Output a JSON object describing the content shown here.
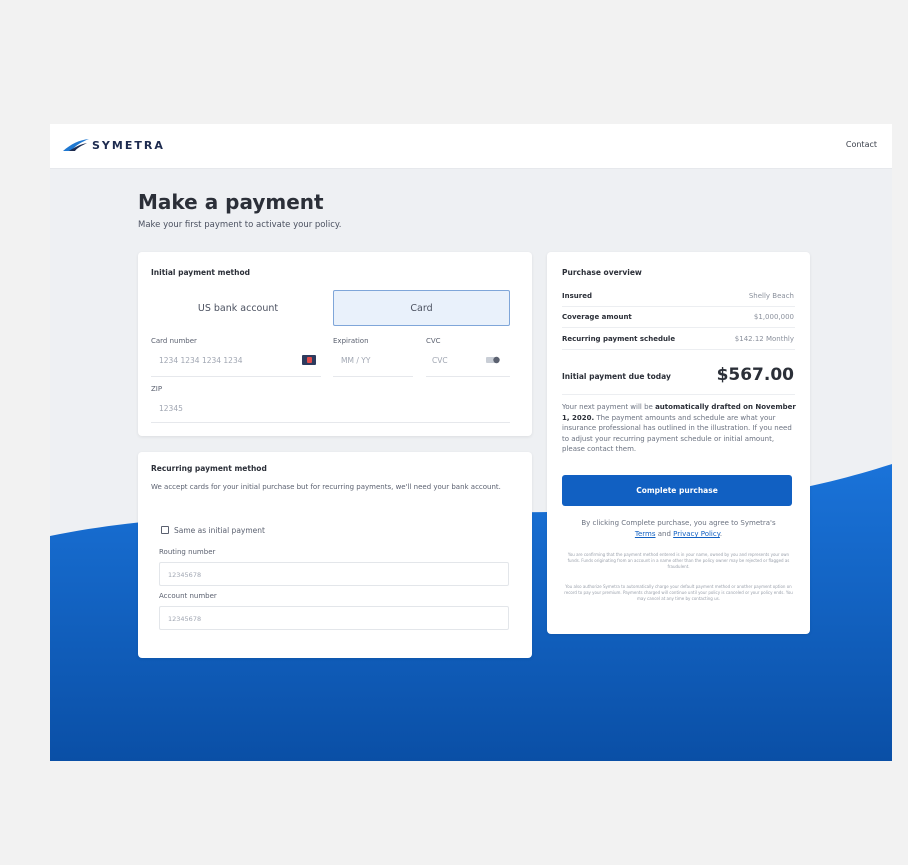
{
  "header": {
    "brand": "SYMETRA",
    "contact_label": "Contact",
    "brand_color": "#1d2b4f",
    "accent_color": "#1160c2"
  },
  "page": {
    "title": "Make a payment",
    "subtitle": "Make your first payment to activate your policy."
  },
  "initial_payment": {
    "section_title": "Initial payment method",
    "tabs": [
      {
        "label": "US bank account",
        "selected": false
      },
      {
        "label": "Card",
        "selected": true
      }
    ],
    "card_number_label": "Card number",
    "card_number_placeholder": "1234 1234 1234 1234",
    "expiration_label": "Expiration",
    "expiration_placeholder": "MM / YY",
    "cvc_label": "CVC",
    "cvc_placeholder": "CVC",
    "zip_label": "ZIP",
    "zip_placeholder": "12345"
  },
  "recurring_payment": {
    "section_title": "Recurring payment method",
    "description": "We accept cards for your initial purchase but for recurring payments, we'll need your bank account.",
    "same_as_initial_label": "Same as initial payment",
    "same_as_initial_checked": false,
    "routing_label": "Routing number",
    "routing_placeholder": "12345678",
    "account_label": "Account number",
    "account_placeholder": "12345678"
  },
  "overview": {
    "section_title": "Purchase overview",
    "rows": [
      {
        "label": "Insured",
        "value": "Shelly Beach"
      },
      {
        "label": "Coverage amount",
        "value": "$1,000,000"
      },
      {
        "label": "Recurring payment schedule",
        "value": "$142.12 Monthly"
      }
    ],
    "due_label": "Initial payment due today",
    "due_value": "$567.00",
    "note_prefix": "Your next payment will be ",
    "note_bold": "automatically drafted on November 1, 2020.",
    "note_suffix": " The payment amounts and schedule are what your insurance professional has outlined in the illustration. If you need to adjust your recurring payment schedule or initial amount, please contact them.",
    "complete_button": "Complete purchase",
    "agree_prefix": "By clicking Complete purchase, you agree to Symetra's",
    "terms_link": "Terms",
    "agree_and": "and",
    "privacy_link": "Privacy Policy",
    "agree_suffix": ".",
    "fine_print_1": "You are confirming that the payment method entered is in your name, owned by you and represents your own funds. Funds originating from an account in a name other than the policy owner may be rejected or flagged as fraudulent.",
    "fine_print_2": "You also authorize Symetra to automatically charge your default payment method or another payment option on record to pay your premium. Payments charged will continue until your policy is canceled or your policy ends. You may cancel at any time by contacting us."
  }
}
